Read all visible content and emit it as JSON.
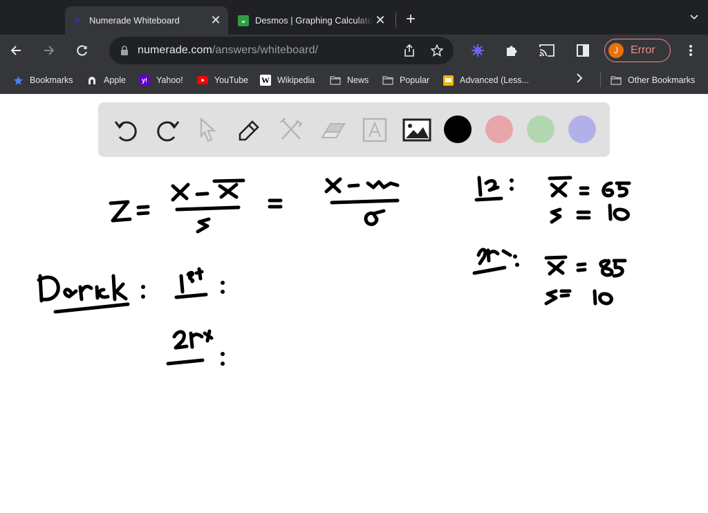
{
  "browser": {
    "tabs": [
      {
        "title": "Numerade Whiteboard",
        "favicon": "numerade-icon",
        "active": true
      },
      {
        "title": "Desmos | Graphing Calculator",
        "favicon": "desmos-icon",
        "active": false
      }
    ],
    "new_tab_label": "+",
    "tab_menu_icon": "chevron-down-icon",
    "url": {
      "domain": "numerade.com",
      "path": "/answers/whiteboard/"
    },
    "profile": {
      "initial": "J",
      "label": "Error",
      "color": "#e8710a",
      "outline_color": "#f28b82"
    },
    "bookmarks": [
      {
        "label": "Bookmarks",
        "icon": "star-icon"
      },
      {
        "label": "Apple",
        "icon": "apple-icon"
      },
      {
        "label": "Yahoo!",
        "icon": "yahoo-icon"
      },
      {
        "label": "YouTube",
        "icon": "youtube-icon"
      },
      {
        "label": "Wikipedia",
        "icon": "wikipedia-icon"
      },
      {
        "label": "News",
        "icon": "folder-icon"
      },
      {
        "label": "Popular",
        "icon": "folder-icon"
      },
      {
        "label": "Advanced (Less...",
        "icon": "slides-icon"
      }
    ],
    "other_bookmarks": "Other Bookmarks"
  },
  "whiteboard": {
    "tools": [
      "undo",
      "redo",
      "select",
      "pen",
      "tools",
      "eraser",
      "text",
      "image"
    ],
    "colors": [
      "#000000",
      "#e8a6ab",
      "#b2d7b0",
      "#b2b0e8"
    ],
    "selected_color": "#000000",
    "handwriting": {
      "formula": "z = (x - x̄)/s = (x - μ)/σ",
      "derick_label": "Derick:",
      "derick_1st": "1st:",
      "derick_2nd": "2nd:",
      "test1": {
        "label": "1st:",
        "mean": "x̄ = 65",
        "sd": "s = 10"
      },
      "test2": {
        "label": "2nd:",
        "mean": "x̄ = 85",
        "sd": "s = 10"
      }
    }
  }
}
